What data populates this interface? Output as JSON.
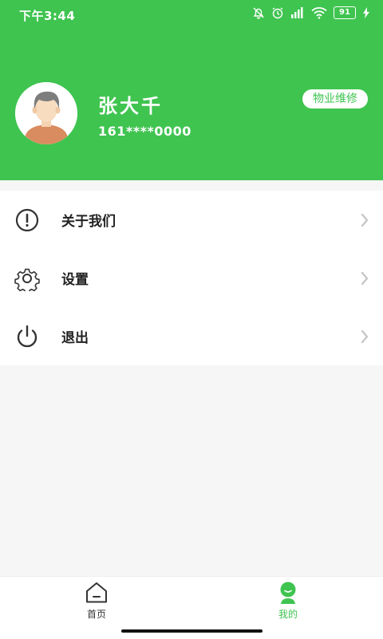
{
  "status_bar": {
    "time": "下午3:44",
    "battery": "91"
  },
  "profile": {
    "name": "张大千",
    "phone": "161****0000",
    "tag_button": "物业维修"
  },
  "menu": {
    "items": [
      {
        "label": "关于我们",
        "icon": "info-circle-icon"
      },
      {
        "label": "设置",
        "icon": "gear-icon"
      },
      {
        "label": "退出",
        "icon": "power-icon"
      }
    ]
  },
  "tabbar": {
    "tabs": [
      {
        "label": "首页",
        "icon": "home-icon",
        "active": false
      },
      {
        "label": "我的",
        "icon": "person-icon",
        "active": true
      }
    ]
  },
  "colors": {
    "brand": "#3fc450",
    "inactive": "#333333"
  }
}
